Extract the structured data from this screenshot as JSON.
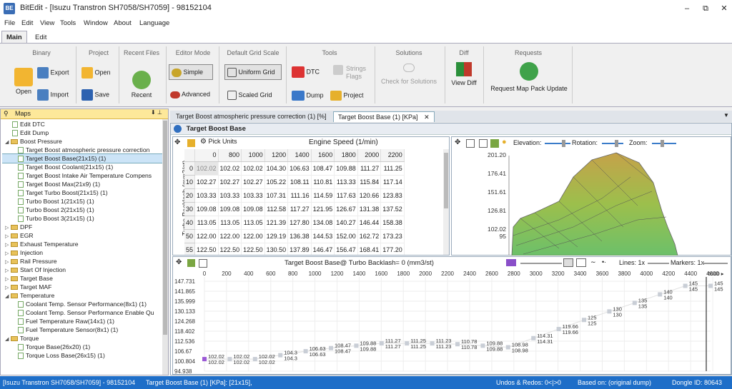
{
  "window": {
    "title": "BitEdit - [Isuzu Transtron SH7058/SH7059] - 98152104",
    "app_icon": "bitedit-app-icon"
  },
  "menu": [
    "File",
    "Edit",
    "View",
    "Tools",
    "Window",
    "About",
    "Language"
  ],
  "ribbon_tabs": [
    "Main",
    "Edit"
  ],
  "ribbon": {
    "binary": {
      "title": "Binary",
      "open": "Open",
      "export": "Export",
      "import": "Import"
    },
    "project": {
      "title": "Project",
      "open": "Open",
      "save": "Save"
    },
    "recent": {
      "title": "Recent Files",
      "recent": "Recent"
    },
    "editor_mode": {
      "title": "Editor Mode",
      "simple": "Simple",
      "advanced": "Advanced"
    },
    "grid_scale": {
      "title": "Default Grid Scale",
      "uniform": "Uniform Grid",
      "scaled": "Scaled Grid"
    },
    "tools": {
      "title": "Tools",
      "dtc": "DTC",
      "strings": "Strings",
      "flags": "Flags",
      "dump": "Dump",
      "project": "Project"
    },
    "solutions": {
      "title": "Solutions",
      "check": "Check for Solutions"
    },
    "diff": {
      "title": "Diff",
      "view": "View Diff"
    },
    "requests": {
      "title": "Requests",
      "update": "Request Map Pack Update"
    }
  },
  "maps_panel": {
    "title": "Maps",
    "pin": "⬇ ⊥",
    "tree": [
      {
        "label": "Edit DTC",
        "level": 1,
        "kind": "doc"
      },
      {
        "label": "Edit Dump",
        "level": 1,
        "kind": "doc"
      },
      {
        "label": "Boost Pressure",
        "level": 0,
        "kind": "folder-open"
      },
      {
        "label": "Target Boost atmospheric pressure correction",
        "level": 2,
        "kind": "doc"
      },
      {
        "label": "Target Boost Base(21x15) (1)",
        "level": 2,
        "kind": "doc",
        "selected": true
      },
      {
        "label": "Target Boost Coolant(21x15) (1)",
        "level": 2,
        "kind": "doc"
      },
      {
        "label": "Target Boost Intake Air Temperature Compens",
        "level": 2,
        "kind": "doc"
      },
      {
        "label": "Target Boost Max(21x9) (1)",
        "level": 2,
        "kind": "doc"
      },
      {
        "label": "Target Turbo Boost(21x15) (1)",
        "level": 2,
        "kind": "doc"
      },
      {
        "label": "Turbo Boost 1(21x15) (1)",
        "level": 2,
        "kind": "doc"
      },
      {
        "label": "Turbo Boost 2(21x15) (1)",
        "level": 2,
        "kind": "doc"
      },
      {
        "label": "Turbo Boost 3(21x15) (1)",
        "level": 2,
        "kind": "doc"
      },
      {
        "label": "DPF",
        "level": 0,
        "kind": "folder"
      },
      {
        "label": "EGR",
        "level": 0,
        "kind": "folder"
      },
      {
        "label": "Exhaust Temperature",
        "level": 0,
        "kind": "folder"
      },
      {
        "label": "Injection",
        "level": 0,
        "kind": "folder"
      },
      {
        "label": "Rail Pressure",
        "level": 0,
        "kind": "folder"
      },
      {
        "label": "Start Of Injection",
        "level": 0,
        "kind": "folder"
      },
      {
        "label": "Target Base",
        "level": 0,
        "kind": "folder"
      },
      {
        "label": "Target MAF",
        "level": 0,
        "kind": "folder"
      },
      {
        "label": "Temperature",
        "level": 0,
        "kind": "folder-open"
      },
      {
        "label": "Coolant Temp. Sensor Performance(8x1) (1)",
        "level": 2,
        "kind": "doc"
      },
      {
        "label": "Coolant Temp. Sensor Performance Enable Qu",
        "level": 2,
        "kind": "doc"
      },
      {
        "label": "Fuel Temperature Raw(14x1) (1)",
        "level": 2,
        "kind": "doc"
      },
      {
        "label": "Fuel Temperature Sensor(8x1) (1)",
        "level": 2,
        "kind": "doc"
      },
      {
        "label": "Torque",
        "level": 0,
        "kind": "folder-open"
      },
      {
        "label": "Torque Base(26x20) (1)",
        "level": 2,
        "kind": "doc"
      },
      {
        "label": "Torque Loss Base(26x15) (1)",
        "level": 2,
        "kind": "doc"
      }
    ]
  },
  "doc_tabs": [
    {
      "label": "Target Boost atmospheric pressure correction (1) [%]",
      "active": false
    },
    {
      "label": "Target Boost Base (1) [KPa]",
      "active": true
    }
  ],
  "doc_tab_close": "✕",
  "main": {
    "panel_title": "Target Boost Base",
    "pick_units": "Pick Units",
    "x_axis_title": "Engine Speed (1/min)",
    "y_axis_title": "Turbo Backlash (mm3/st)",
    "columns": [
      "0",
      "800",
      "1000",
      "1200",
      "1400",
      "1600",
      "1800",
      "2000",
      "2200"
    ],
    "rows": [
      {
        "y": "0",
        "v": [
          "102.02",
          "102.02",
          "102.02",
          "104.30",
          "106.63",
          "108.47",
          "109.88",
          "111.27",
          "111.25"
        ]
      },
      {
        "y": "10",
        "v": [
          "102.27",
          "102.27",
          "102.27",
          "105.22",
          "108.11",
          "110.81",
          "113.33",
          "115.84",
          "117.14"
        ]
      },
      {
        "y": "20",
        "v": [
          "103.33",
          "103.33",
          "103.33",
          "107.31",
          "111.16",
          "114.59",
          "117.63",
          "120.66",
          "123.83"
        ]
      },
      {
        "y": "30",
        "v": [
          "109.08",
          "109.08",
          "109.08",
          "112.58",
          "117.27",
          "121.95",
          "126.67",
          "131.38",
          "137.52"
        ]
      },
      {
        "y": "40",
        "v": [
          "113.05",
          "113.05",
          "113.05",
          "121.39",
          "127.80",
          "134.08",
          "140.27",
          "146.44",
          "158.38"
        ]
      },
      {
        "y": "50",
        "v": [
          "122.00",
          "122.00",
          "122.00",
          "129.19",
          "136.38",
          "144.53",
          "152.00",
          "162.72",
          "173.23"
        ]
      },
      {
        "y": "55",
        "v": [
          "122.50",
          "122.50",
          "122.50",
          "130.50",
          "137.89",
          "146.47",
          "156.47",
          "168.41",
          "177.20"
        ]
      }
    ]
  },
  "plot3d": {
    "toolbar": {
      "elevation": "Elevation:",
      "rotation": "Rotation:",
      "zoom": "Zoom:"
    },
    "z_ticks": [
      "201.20",
      "176.41",
      "151.61",
      "126.81",
      "102.02",
      "95"
    ]
  },
  "chart_toolbar": {
    "title": "Target Boost Base@ Turbo Backlash= 0 (mm3/st)",
    "lines": "Lines: 1x",
    "markers": "Markers: 1x"
  },
  "chart_data": {
    "type": "line",
    "x": [
      0,
      800,
      1000,
      1200,
      1400,
      1600,
      1800,
      2000,
      2200,
      2400,
      2600,
      2800,
      3000,
      3200,
      3400,
      3600,
      3800,
      4000,
      4200,
      4400,
      4600
    ],
    "x_ticks": [
      "0",
      "200",
      "400",
      "600",
      "800",
      "1000",
      "1200",
      "1400",
      "1600",
      "1800",
      "2000",
      "2200",
      "2400",
      "2600",
      "2800",
      "3000",
      "3200",
      "3400",
      "3600",
      "3800",
      "4000",
      "4200",
      "4400",
      "4600"
    ],
    "y_ticks": [
      "147.731",
      "141.865",
      "135.999",
      "130.133",
      "124.268",
      "118.402",
      "112.536",
      "106.67",
      "100.804",
      "94.938"
    ],
    "ylim": [
      94.938,
      147.731
    ],
    "series": [
      {
        "values": [
          102.02,
          102.02,
          102.02,
          104.3,
          106.63,
          108.47,
          109.88,
          111.27,
          111.25,
          111.23,
          110.78,
          109.88,
          108.98,
          114.31,
          119.66,
          125,
          130,
          135,
          140,
          145,
          145
        ]
      }
    ],
    "cursor_label": "6000 ▸"
  },
  "status": {
    "left": "[Isuzu Transtron SH7058/SH7059] - 98152104",
    "map": "Target Boost Base (1) [KPa]: [21x15],",
    "undo": "Undos & Redos: 0<|>0",
    "based": "Based on: (original dump)",
    "dongle": "Dongle ID: 80643"
  }
}
